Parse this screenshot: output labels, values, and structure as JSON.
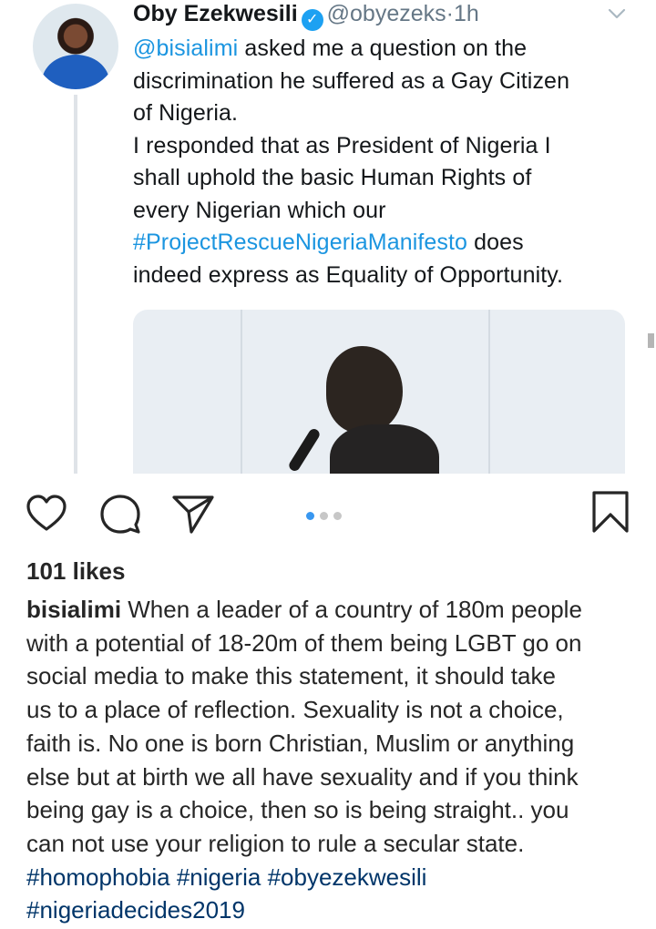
{
  "tweet": {
    "author_name": "Oby Ezekwesili",
    "handle": "@obyezeks",
    "separator": "·",
    "time": "1h",
    "body": {
      "l1_mention": "@bisialimi",
      "l1_rest": " asked me a question on the",
      "l2": "discrimination he suffered as a Gay Citizen",
      "l3": "of Nigeria.",
      "l4": "I responded that as President of Nigeria I",
      "l5": "shall uphold the basic Human Rights of",
      "l6": "every Nigerian which our",
      "l7_hashtag": "#ProjectRescueNigeriaManifesto",
      "l7_rest": " does",
      "l8": "indeed express as Equality of Opportunity."
    }
  },
  "post": {
    "likes": "101 likes",
    "carousel": {
      "count": 3,
      "active_index": 0
    },
    "caption": {
      "username": "bisialimi",
      "l1": " When a leader of a country of 180m people",
      "l2": "with a potential of 18-20m of them being LGBT go on",
      "l3": "social media to make this statement, it should take",
      "l4": "us to a place of reflection. Sexuality is not a choice,",
      "l5": "faith is. No one is born Christian, Muslim or anything",
      "l6": "else but at birth we all have sexuality and if you think",
      "l7": "being gay is a choice, then so is being straight.. you",
      "l8": "can not use your religion to rule a secular state.",
      "hashtags_line1": [
        "#homophobia",
        "#nigeria",
        "#obyezekwesili"
      ],
      "hashtags_line2": [
        "#nigeriadecides2019"
      ]
    }
  },
  "icons": {
    "like": "heart-icon",
    "comment": "comment-bubble-icon",
    "share": "paper-plane-icon",
    "save": "bookmark-icon",
    "verified": "verified-badge-icon",
    "tweet_menu": "chevron-down-icon"
  },
  "colors": {
    "twitter_link": "#1b95e0",
    "verified": "#1da1f2",
    "ig_hashtag": "#003569",
    "carousel_active": "#3897f0"
  }
}
